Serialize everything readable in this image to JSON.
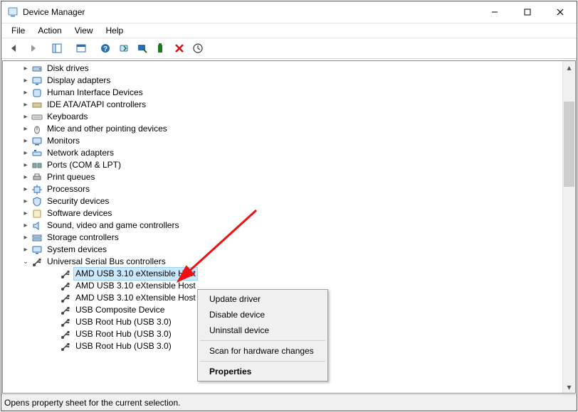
{
  "title": "Device Manager",
  "menus": {
    "file": "File",
    "action": "Action",
    "view": "View",
    "help": "Help"
  },
  "tree": {
    "items": [
      {
        "label": "Disk drives",
        "icon": "disk-icon"
      },
      {
        "label": "Display adapters",
        "icon": "display-icon"
      },
      {
        "label": "Human Interface Devices",
        "icon": "hid-icon"
      },
      {
        "label": "IDE ATA/ATAPI controllers",
        "icon": "ide-icon"
      },
      {
        "label": "Keyboards",
        "icon": "keyboard-icon"
      },
      {
        "label": "Mice and other pointing devices",
        "icon": "mouse-icon"
      },
      {
        "label": "Monitors",
        "icon": "monitor-icon"
      },
      {
        "label": "Network adapters",
        "icon": "network-icon"
      },
      {
        "label": "Ports (COM & LPT)",
        "icon": "ports-icon"
      },
      {
        "label": "Print queues",
        "icon": "printer-icon"
      },
      {
        "label": "Processors",
        "icon": "cpu-icon"
      },
      {
        "label": "Security devices",
        "icon": "security-icon"
      },
      {
        "label": "Software devices",
        "icon": "software-icon"
      },
      {
        "label": "Sound, video and game controllers",
        "icon": "sound-icon"
      },
      {
        "label": "Storage controllers",
        "icon": "storage-icon"
      },
      {
        "label": "System devices",
        "icon": "system-icon"
      }
    ],
    "expanded": {
      "label": "Universal Serial Bus controllers",
      "children": [
        "AMD USB 3.10 eXtensible Host",
        "AMD USB 3.10 eXtensible Host",
        "AMD USB 3.10 eXtensible Host",
        "USB Composite Device",
        "USB Root Hub (USB 3.0)",
        "USB Root Hub (USB 3.0)",
        "USB Root Hub (USB 3.0)"
      ]
    }
  },
  "context": {
    "update": "Update driver",
    "disable": "Disable device",
    "uninstall": "Uninstall device",
    "scan": "Scan for hardware changes",
    "properties": "Properties"
  },
  "status": "Opens property sheet for the current selection."
}
